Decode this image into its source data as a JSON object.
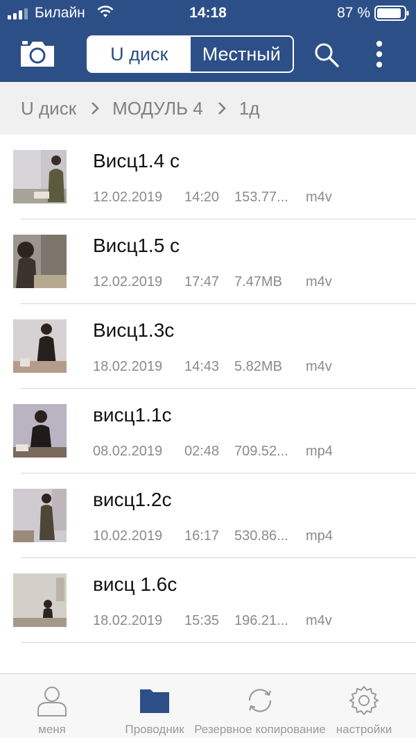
{
  "status_bar": {
    "carrier": "Билайн",
    "time": "14:18",
    "battery_percent": "87 %"
  },
  "nav": {
    "tabs": [
      {
        "label": "U диск",
        "active": true
      },
      {
        "label": "Местный",
        "active": false
      }
    ],
    "icons": [
      "camera-icon",
      "search-icon",
      "more-vertical-icon"
    ]
  },
  "breadcrumb": [
    "U диск",
    "МОДУЛЬ 4",
    "1д"
  ],
  "files": [
    {
      "name": "Висц1.4 с",
      "date": "12.02.2019",
      "time": "14:20",
      "size": "153.77...",
      "ext": "m4v"
    },
    {
      "name": "Висц1.5 с",
      "date": "12.02.2019",
      "time": "17:47",
      "size": "7.47MB",
      "ext": "m4v"
    },
    {
      "name": "Висц1.3с",
      "date": "18.02.2019",
      "time": "14:43",
      "size": "5.82MB",
      "ext": "m4v"
    },
    {
      "name": "висц1.1с",
      "date": "08.02.2019",
      "time": "02:48",
      "size": "709.52...",
      "ext": "mp4"
    },
    {
      "name": "висц1.2с",
      "date": "10.02.2019",
      "time": "16:17",
      "size": "530.86...",
      "ext": "mp4"
    },
    {
      "name": "висц 1.6с",
      "date": "18.02.2019",
      "time": "15:35",
      "size": "196.21...",
      "ext": "m4v"
    }
  ],
  "tabbar": [
    {
      "label": "меня",
      "icon": "person-icon",
      "active": false
    },
    {
      "label": "Проводник",
      "icon": "folder-icon",
      "active": true
    },
    {
      "label": "Резервное копирование",
      "icon": "sync-icon",
      "active": false
    },
    {
      "label": "настройки",
      "icon": "gear-icon",
      "active": false
    }
  ],
  "colors": {
    "accent": "#2c4f88",
    "breadcrumb_bg": "#f0f0f0",
    "meta_text": "#8a8a8a"
  }
}
